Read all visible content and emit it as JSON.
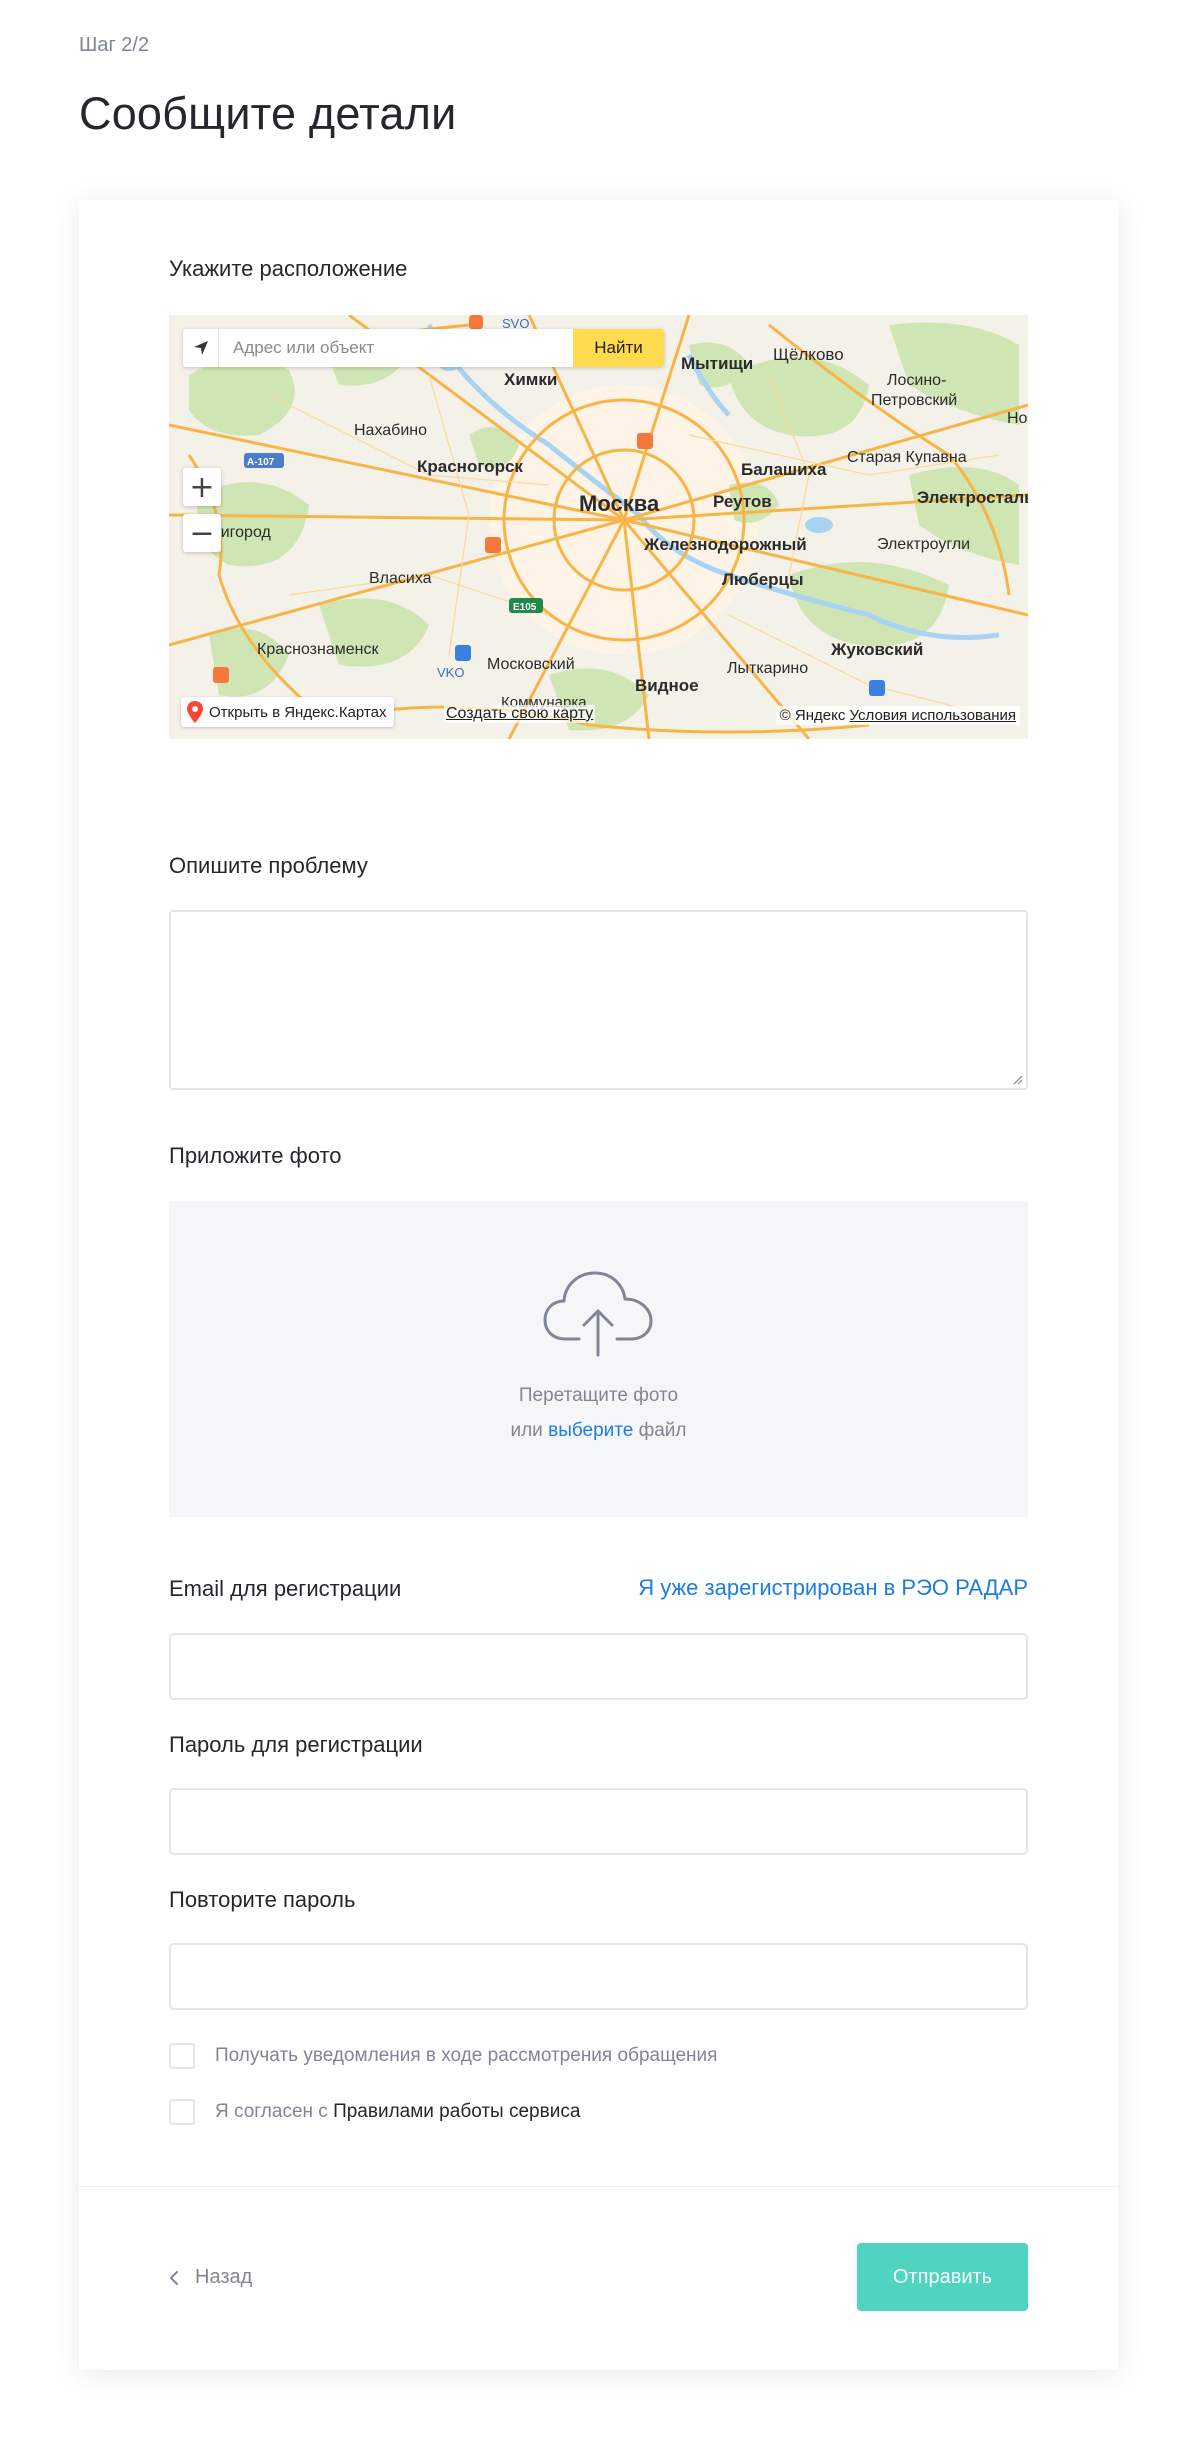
{
  "step": "Шаг 2/2",
  "title": "Сообщите детали",
  "location": {
    "label": "Укажите расположение",
    "map": {
      "search_placeholder": "Адрес или объект",
      "find_button": "Найти",
      "zoom_in": "+",
      "zoom_out": "−",
      "open_link": "Открыть в Яндекс.Картах",
      "create_link": "Создать свою карту",
      "copyright": "© Яндекс",
      "terms": "Условия использования",
      "places": [
        "Химки",
        "Мытищи",
        "Щёлково",
        "Лосино-",
        "Петровский",
        "Нахабино",
        "Красногорск",
        "Балашиха",
        "Старая Купавна",
        "Москва",
        "Реутов",
        "Электросталь",
        "Звенигород",
        "Железнодорожный",
        "Электроугли",
        "Власиха",
        "Люберцы",
        "Краснознаменск",
        "Московский",
        "Видное",
        "Лыткарино",
        "Жуковский",
        "SVO",
        "VKO",
        "A-107",
        "E105",
        "Коммунарка",
        "Но"
      ],
      "colors": {
        "road": "#f7b548",
        "green": "#cfe6b4",
        "water": "#a9d3f2",
        "land": "#f4f1e9",
        "city": "#fdf3e6"
      }
    }
  },
  "problem": {
    "label": "Опишите проблему",
    "value": ""
  },
  "photo": {
    "label": "Приложите фото",
    "drop_text": "Перетащите фото",
    "or_text": "или",
    "choose_link": "выберите",
    "file_text": "файл"
  },
  "email": {
    "label": "Email для регистрации",
    "registered_link": "Я уже зарегистрирован в РЭО РАДАР",
    "value": ""
  },
  "password": {
    "label": "Пароль для регистрации",
    "value": ""
  },
  "password_repeat": {
    "label": "Повторите пароль",
    "value": ""
  },
  "checkboxes": {
    "notify": "Получать уведомления в ходе рассмотрения обращения",
    "agree_prefix": "Я согласен с",
    "agree_rules": "Правилами работы сервиса"
  },
  "footer": {
    "back": "Назад",
    "submit": "Отправить"
  },
  "colors": {
    "accent_link": "#1d7ee0",
    "submit_button": "#4fd4bf",
    "muted_text": "#7f8695"
  }
}
